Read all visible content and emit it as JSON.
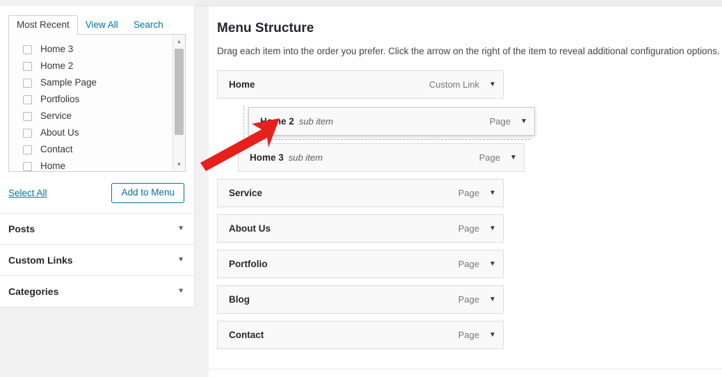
{
  "sidebar": {
    "tabs": [
      {
        "label": "Most Recent",
        "active": true
      },
      {
        "label": "View All",
        "active": false
      },
      {
        "label": "Search",
        "active": false
      }
    ],
    "list_items": [
      {
        "label": "Home 3",
        "checked": false
      },
      {
        "label": "Home 2",
        "checked": false
      },
      {
        "label": "Sample Page",
        "checked": false
      },
      {
        "label": "Portfolios",
        "checked": false
      },
      {
        "label": "Service",
        "checked": false
      },
      {
        "label": "About Us",
        "checked": false
      },
      {
        "label": "Contact",
        "checked": false
      },
      {
        "label": "Home",
        "checked": false
      }
    ],
    "select_all_label": "Select All",
    "add_to_menu_label": "Add to Menu",
    "panels": [
      {
        "title": "Posts",
        "caret": "▼"
      },
      {
        "title": "Custom Links",
        "caret": "▼"
      },
      {
        "title": "Categories",
        "caret": "▼"
      }
    ]
  },
  "main": {
    "title": "Menu Structure",
    "description": "Drag each item into the order you prefer. Click the arrow on the right of the item to reveal additional configuration options.",
    "menu_items": [
      {
        "title": "Home",
        "sub_label": "",
        "type": "Custom Link",
        "depth": 0,
        "state": "normal"
      },
      {
        "title": "Home 2",
        "sub_label": "sub item",
        "type": "Page",
        "depth": 1,
        "state": "dragging"
      },
      {
        "title": "Home 3",
        "sub_label": "sub item",
        "type": "Page",
        "depth": 1,
        "state": "normal"
      },
      {
        "title": "Service",
        "sub_label": "",
        "type": "Page",
        "depth": 0,
        "state": "normal"
      },
      {
        "title": "About Us",
        "sub_label": "",
        "type": "Page",
        "depth": 0,
        "state": "normal"
      },
      {
        "title": "Portfolio",
        "sub_label": "",
        "type": "Page",
        "depth": 0,
        "state": "normal"
      },
      {
        "title": "Blog",
        "sub_label": "",
        "type": "Page",
        "depth": 0,
        "state": "normal"
      },
      {
        "title": "Contact",
        "sub_label": "",
        "type": "Page",
        "depth": 0,
        "state": "normal"
      }
    ],
    "caret_glyph": "▼"
  },
  "annotation": {
    "arrow_color": "#e8201c",
    "arrow_points_to": "Home 2 menu item left edge"
  },
  "colors": {
    "link": "#0073aa",
    "row_bg": "#f9f9f9",
    "row_border": "#dcdcdc",
    "page_bg": "#f1f1f1"
  },
  "scrollbar": {
    "up_glyph": "▲",
    "down_glyph": "▼"
  }
}
